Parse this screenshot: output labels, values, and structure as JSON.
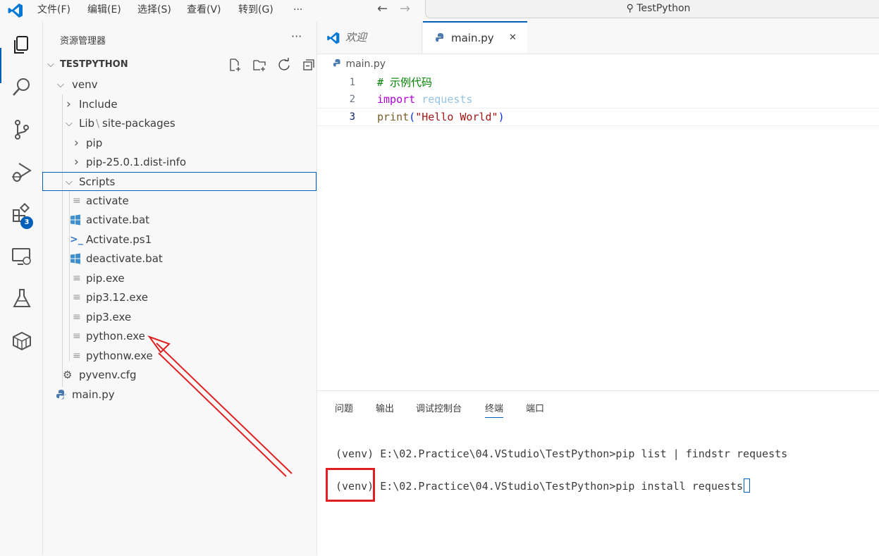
{
  "titlebar": {
    "menus": [
      "文件(F)",
      "编辑(E)",
      "选择(S)",
      "查看(V)",
      "转到(G)",
      "···"
    ],
    "search_text": "TestPython"
  },
  "activity": {
    "extensions_badge": "3"
  },
  "sidebar": {
    "title": "资源管理器",
    "more": "···",
    "root": "TESTPYTHON",
    "tree": [
      {
        "label": "venv",
        "chevron": "⌵"
      },
      {
        "label": "Include",
        "chevron": "›"
      },
      {
        "label": "Lib",
        "label2": "site-packages",
        "chevron": "⌵"
      },
      {
        "label": "pip",
        "chevron": "›"
      },
      {
        "label": "pip-25.0.1.dist-info",
        "chevron": "›"
      },
      {
        "label": "Scripts",
        "chevron": "⌵"
      },
      {
        "label": "activate"
      },
      {
        "label": "activate.bat"
      },
      {
        "label": "Activate.ps1"
      },
      {
        "label": "deactivate.bat"
      },
      {
        "label": "pip.exe"
      },
      {
        "label": "pip3.12.exe"
      },
      {
        "label": "pip3.exe"
      },
      {
        "label": "python.exe"
      },
      {
        "label": "pythonw.exe"
      },
      {
        "label": "pyvenv.cfg"
      },
      {
        "label": "main.py"
      }
    ]
  },
  "editor": {
    "tabs": [
      {
        "label": "欢迎"
      },
      {
        "label": "main.py",
        "close": "✕"
      }
    ],
    "breadcrumb": "main.py",
    "lines": [
      {
        "num": "1",
        "comment": "# 示例代码"
      },
      {
        "num": "2",
        "kw": "import",
        "mod": " requests"
      },
      {
        "num": "3",
        "fn": "print",
        "p1": "(",
        "str": "\"Hello World\"",
        "p2": ")"
      }
    ]
  },
  "panel": {
    "tabs": [
      "问题",
      "输出",
      "调试控制台",
      "终端",
      "端口"
    ],
    "terminal": [
      "(venv) E:\\02.Practice\\04.VStudio\\TestPython>pip list | findstr requests",
      "(venv) E:\\02.Practice\\04.VStudio\\TestPython>pip install requests"
    ]
  },
  "colors": {
    "accent": "#005fb8",
    "annotation": "#e02020",
    "keyword": "#af00db",
    "string": "#a31515",
    "comment": "#008000",
    "function": "#795e26"
  }
}
